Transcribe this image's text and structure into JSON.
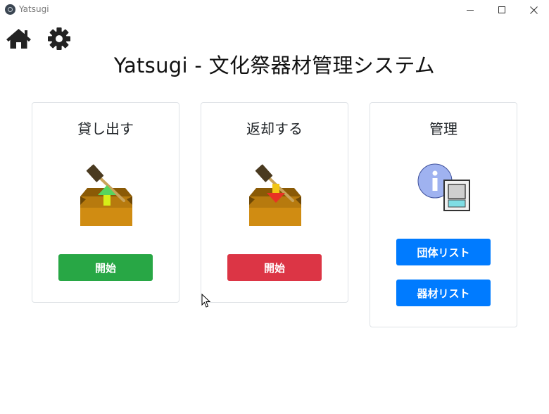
{
  "window": {
    "title": "Yatsugi",
    "controls": [
      "minimize",
      "maximize",
      "close"
    ]
  },
  "toolbar": {
    "home_icon": "home-icon",
    "settings_icon": "gear-icon"
  },
  "page": {
    "title": "Yatsugi - 文化祭器材管理システム"
  },
  "cards": {
    "lend": {
      "title": "貸し出す",
      "icon": "box-upload-icon",
      "button": "開始"
    },
    "return": {
      "title": "返却する",
      "icon": "box-download-icon",
      "button": "開始"
    },
    "manage": {
      "title": "管理",
      "icon": "info-database-icon",
      "buttons": [
        "団体リスト",
        "器材リスト"
      ]
    }
  },
  "colors": {
    "success": "#28a745",
    "danger": "#dc3545",
    "primary": "#007bff",
    "card_border": "#dee2e6"
  }
}
